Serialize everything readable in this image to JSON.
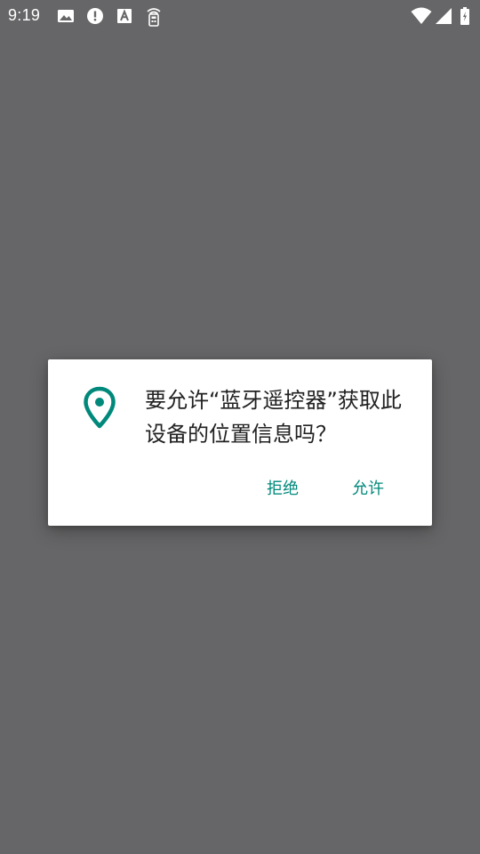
{
  "status_bar": {
    "time": "9:19",
    "left_icons": [
      "image-icon",
      "alert-icon",
      "font-a-icon",
      "remote-control-icon"
    ],
    "right_icons": [
      "wifi-icon",
      "signal-icon",
      "battery-icon"
    ]
  },
  "dialog": {
    "icon": "location-pin-icon",
    "message": "要允许“蓝牙遥控器”获取此设备的位置信息吗？",
    "deny_label": "拒绝",
    "allow_label": "允许"
  },
  "colors": {
    "scrim": "#666668",
    "dialog_background": "#ffffff",
    "accent": "#00897b",
    "message_text": "#212121"
  }
}
